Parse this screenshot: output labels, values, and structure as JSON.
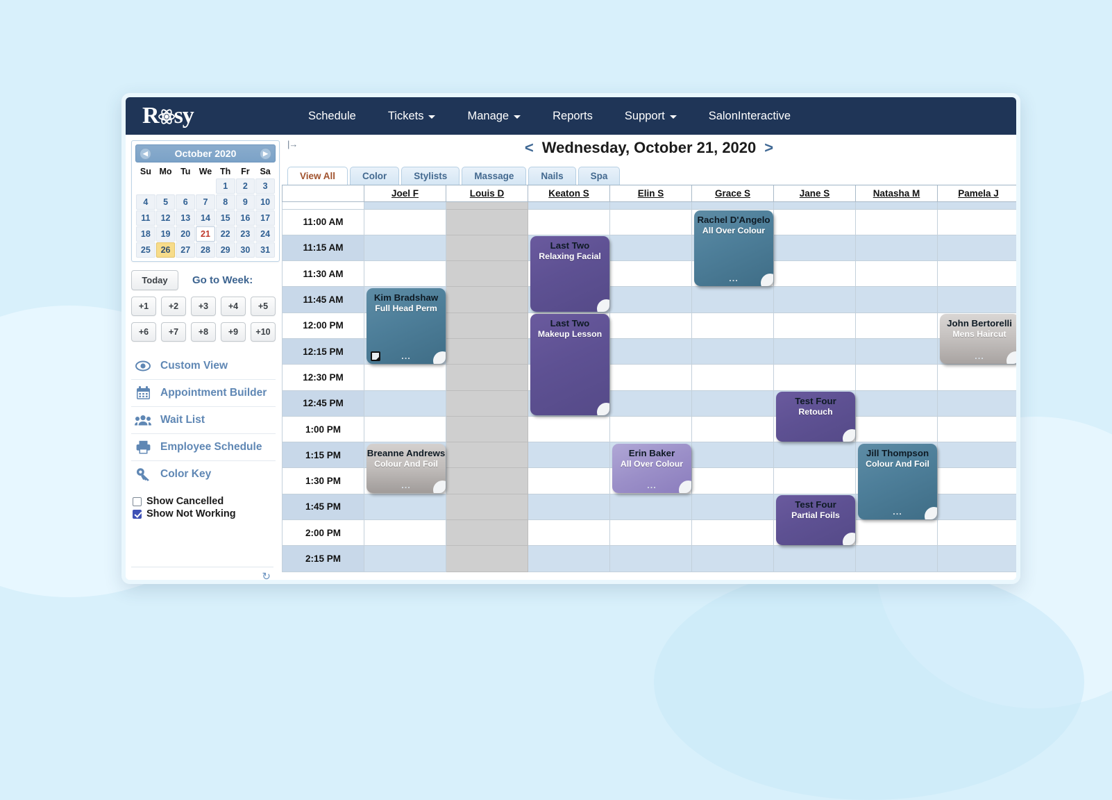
{
  "brand": {
    "name": "Rosy"
  },
  "nav": [
    {
      "label": "Schedule",
      "caret": false
    },
    {
      "label": "Tickets",
      "caret": true
    },
    {
      "label": "Manage",
      "caret": true
    },
    {
      "label": "Reports",
      "caret": false
    },
    {
      "label": "Support",
      "caret": true
    },
    {
      "label": "SalonInteractive",
      "caret": false
    }
  ],
  "sidebar": {
    "calendar": {
      "title": "October 2020",
      "prev_icon": "chevron-left-icon",
      "next_icon": "chevron-right-icon",
      "weekdays": [
        "Su",
        "Mo",
        "Tu",
        "We",
        "Th",
        "Fr",
        "Sa"
      ],
      "weeks": [
        [
          "",
          "",
          "",
          "",
          "1",
          "2",
          "3"
        ],
        [
          "4",
          "5",
          "6",
          "7",
          "8",
          "9",
          "10"
        ],
        [
          "11",
          "12",
          "13",
          "14",
          "15",
          "16",
          "17"
        ],
        [
          "18",
          "19",
          "20",
          "21",
          "22",
          "23",
          "24"
        ],
        [
          "25",
          "26",
          "27",
          "28",
          "29",
          "30",
          "31"
        ]
      ],
      "today_date": "21",
      "selected_date": "26"
    },
    "today_label": "Today",
    "goto_week_label": "Go to Week:",
    "week_buttons": [
      "+1",
      "+2",
      "+3",
      "+4",
      "+5",
      "+6",
      "+7",
      "+8",
      "+9",
      "+10"
    ],
    "links": [
      {
        "label": "Custom View",
        "icon": "eye-icon"
      },
      {
        "label": "Appointment Builder",
        "icon": "calendar-icon"
      },
      {
        "label": "Wait List",
        "icon": "people-icon"
      },
      {
        "label": "Employee Schedule",
        "icon": "printer-icon"
      },
      {
        "label": "Color Key",
        "icon": "key-icon"
      }
    ],
    "checkboxes": [
      {
        "label": "Show Cancelled",
        "checked": false
      },
      {
        "label": "Show Not Working",
        "checked": true
      }
    ],
    "refresh_icon": "refresh-icon"
  },
  "main": {
    "collapse_icon": "collapse-panel-icon",
    "date_title": "Wednesday, October 21, 2020",
    "prev_day": "<",
    "next_day": ">",
    "tabs": [
      {
        "label": "View All",
        "active": true
      },
      {
        "label": "Color",
        "active": false
      },
      {
        "label": "Stylists",
        "active": false
      },
      {
        "label": "Massage",
        "active": false
      },
      {
        "label": "Nails",
        "active": false
      },
      {
        "label": "Spa",
        "active": false
      }
    ],
    "columns": [
      "Joel F",
      "Louis D",
      "Keaton S",
      "Elin S",
      "Grace S",
      "Jane S",
      "Natasha M",
      "Pamela J"
    ],
    "not_working_columns": [
      "Louis D"
    ],
    "times": [
      "11:00 AM",
      "11:15 AM",
      "11:30 AM",
      "11:45 AM",
      "12:00 PM",
      "12:15 PM",
      "12:30 PM",
      "12:45 PM",
      "1:00 PM",
      "1:15 PM",
      "1:30 PM",
      "1:45 PM",
      "2:00 PM",
      "2:15 PM"
    ],
    "appointments": [
      {
        "client": "Rachel D'Angelo",
        "service": "All Over Colour",
        "column": "Grace S",
        "start": "11:00 AM",
        "end": "11:45 AM",
        "color": "teal",
        "dots": "...",
        "note": false
      },
      {
        "client": "Last Two",
        "service": "Relaxing Facial",
        "column": "Keaton S",
        "start": "11:15 AM",
        "end": "12:00 PM",
        "color": "purple",
        "dots": "",
        "note": false
      },
      {
        "client": "Kim Bradshaw",
        "service": "Full Head Perm",
        "column": "Joel F",
        "start": "11:45 AM",
        "end": "12:30 PM",
        "color": "teal",
        "dots": "...",
        "note": true
      },
      {
        "client": "Last Two",
        "service": "Makeup Lesson",
        "column": "Keaton S",
        "start": "12:00 PM",
        "end": "1:00 PM",
        "color": "purple",
        "dots": "",
        "note": false
      },
      {
        "client": "John Bertorelli",
        "service": "Mens Haircut",
        "column": "Pamela J",
        "start": "12:00 PM",
        "end": "12:30 PM",
        "color": "silver",
        "dots": "...",
        "note": false
      },
      {
        "client": "Test Four",
        "service": "Retouch",
        "column": "Jane S",
        "start": "12:45 PM",
        "end": "1:15 PM",
        "color": "purple",
        "dots": "",
        "note": false
      },
      {
        "client": "Breanne Andrews",
        "service": "Colour And Foil",
        "column": "Joel F",
        "start": "1:15 PM",
        "end": "1:45 PM",
        "color": "silver2",
        "dots": "...",
        "note": false
      },
      {
        "client": "Erin Baker",
        "service": "All Over Colour",
        "column": "Elin S",
        "start": "1:15 PM",
        "end": "1:45 PM",
        "color": "lilac",
        "dots": "...",
        "note": false
      },
      {
        "client": "Jill Thompson",
        "service": "Colour And Foil",
        "column": "Natasha M",
        "start": "1:15 PM",
        "end": "2:00 PM",
        "color": "teal",
        "dots": "...",
        "note": false
      },
      {
        "client": "Test Four",
        "service": "Partial Foils",
        "column": "Jane S",
        "start": "1:45 PM",
        "end": "2:15 PM",
        "color": "purple",
        "dots": "",
        "note": false
      }
    ]
  },
  "colors": {
    "navbar": "#1f3557",
    "accent_link": "#5f87b4",
    "active_tab_text": "#a0522d",
    "today_date": "#c0392b",
    "selected_date_bg": "#f7dc8a",
    "teal": "#4e7f9a",
    "purple": "#5e5193",
    "lilac": "#9b8fc8",
    "silver": "#c6c2c0",
    "not_working": "#cfcfcf"
  }
}
